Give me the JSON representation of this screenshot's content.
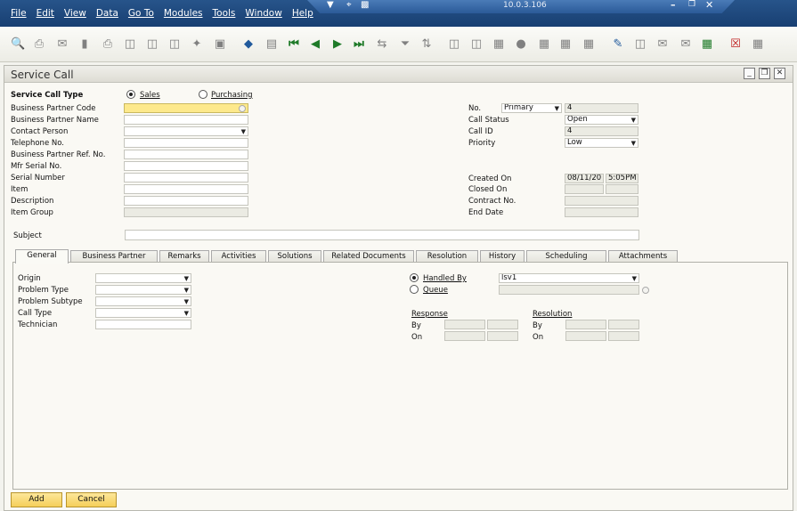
{
  "menubar": {
    "items": [
      "File",
      "Edit",
      "View",
      "Data",
      "Go To",
      "Modules",
      "Tools",
      "Window",
      "Help"
    ],
    "server_address": "10.0.3.106"
  },
  "toolbar": {
    "icons": [
      "print-preview-icon",
      "print-icon",
      "email-icon",
      "sms-icon",
      "fax-icon",
      "export-excel-icon",
      "export-word-icon",
      "export-pdf-icon",
      "launch-application-icon",
      "lock-screen-icon",
      "find-icon",
      "add-icon",
      "first-record-icon",
      "previous-record-icon",
      "next-record-icon",
      "last-record-icon",
      "refresh-icon",
      "filter-icon",
      "sort-icon",
      "base-document-icon",
      "target-document-icon",
      "gross-profit-icon",
      "payment-means-icon",
      "volume-weight-icon",
      "journal-voucher-icon",
      "document-generation-icon",
      "user-define-icon",
      "form-settings-icon",
      "message-icon",
      "alert-icon",
      "calendar-icon",
      "approval-icon",
      "close-app-icon"
    ]
  },
  "window": {
    "title": "Service Call"
  },
  "form": {
    "call_type_label": "Service Call Type",
    "call_type_options": [
      "Sales",
      "Purchasing"
    ],
    "left_labels": [
      "Business Partner Code",
      "Business Partner Name",
      "Contact Person",
      "Telephone No.",
      "Business Partner Ref. No.",
      "Mfr Serial No.",
      "Serial Number",
      "Item",
      "Description",
      "Item Group"
    ],
    "right": {
      "no_label": "No.",
      "series_value": "Primary",
      "no_value": "4",
      "call_status_label": "Call Status",
      "call_status_value": "Open",
      "call_id_label": "Call ID",
      "call_id_value": "4",
      "priority_label": "Priority",
      "priority_value": "Low",
      "created_on_label": "Created On",
      "created_date": "08/11/20",
      "created_time": "5:05PM",
      "closed_on_label": "Closed On",
      "contract_no_label": "Contract No.",
      "end_date_label": "End Date"
    },
    "subject_label": "Subject"
  },
  "tabs": [
    "General",
    "Business Partner",
    "Remarks",
    "Activities",
    "Solutions",
    "Related Documents",
    "Resolution",
    "History",
    "Scheduling",
    "Attachments"
  ],
  "general": {
    "left_labels": [
      "Origin",
      "Problem Type",
      "Problem Subtype",
      "Call Type",
      "Technician"
    ],
    "handled_by_label": "Handled By",
    "handled_by_value": "lsv1",
    "queue_label": "Queue",
    "response_label": "Response",
    "resolution_label": "Resolution",
    "by_label": "By",
    "on_label": "On"
  },
  "buttons": {
    "add": "Add",
    "cancel": "Cancel"
  }
}
